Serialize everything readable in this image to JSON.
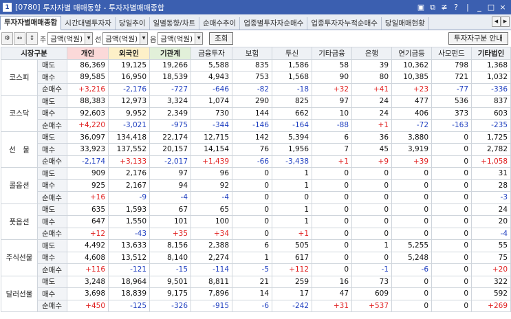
{
  "window": {
    "code": "[0780]",
    "title": "투자자별 매매동향 - 투자자별매매종합",
    "icon_label": "1",
    "controls": [
      "▣",
      "⧉",
      "≢",
      "?",
      "|",
      "_",
      "□",
      "×"
    ]
  },
  "tabs": [
    "투자자별매매종합",
    "시간대별투자자",
    "당일추이",
    "일별동향/차트",
    "순매수추이",
    "업종별투자자순매수",
    "업종투자자누적순매수",
    "당일매매현황"
  ],
  "toolbar": {
    "label_stock": "주",
    "label_futures": "선",
    "label_options": "옵",
    "select_stock": "금액(억원)",
    "select_futures": "금액(억원)",
    "select_options": "금액(억원)",
    "query_button": "조회",
    "guide_button": "투자자구분 안내"
  },
  "headers": [
    "시장구분",
    "개인",
    "외국인",
    "기관계",
    "금융투자",
    "보험",
    "투신",
    "기타금융",
    "은행",
    "연기금등",
    "사모펀드",
    "기타법인"
  ],
  "row_types": [
    "매도",
    "매수",
    "순매수"
  ],
  "markets": [
    {
      "name": "코스피",
      "rows": [
        [
          "86,369",
          "19,125",
          "19,266",
          "5,588",
          "835",
          "1,586",
          "58",
          "39",
          "10,362",
          "798",
          "1,368"
        ],
        [
          "89,585",
          "16,950",
          "18,539",
          "4,943",
          "753",
          "1,568",
          "90",
          "80",
          "10,385",
          "721",
          "1,032"
        ],
        [
          "+3,216",
          "-2,176",
          "-727",
          "-646",
          "-82",
          "-18",
          "+32",
          "+41",
          "+23",
          "-77",
          "-336"
        ]
      ]
    },
    {
      "name": "코스닥",
      "rows": [
        [
          "88,383",
          "12,973",
          "3,324",
          "1,074",
          "290",
          "825",
          "97",
          "24",
          "477",
          "536",
          "837"
        ],
        [
          "92,603",
          "9,952",
          "2,349",
          "730",
          "144",
          "662",
          "10",
          "24",
          "406",
          "373",
          "603"
        ],
        [
          "+4,220",
          "-3,021",
          "-975",
          "-344",
          "-146",
          "-164",
          "-88",
          "+1",
          "-72",
          "-163",
          "-235"
        ]
      ]
    },
    {
      "name": "선　물",
      "rows": [
        [
          "36,097",
          "134,418",
          "22,174",
          "12,715",
          "142",
          "5,394",
          "6",
          "36",
          "3,880",
          "0",
          "1,725"
        ],
        [
          "33,923",
          "137,552",
          "20,157",
          "14,154",
          "76",
          "1,956",
          "7",
          "45",
          "3,919",
          "0",
          "2,782"
        ],
        [
          "-2,174",
          "+3,133",
          "-2,017",
          "+1,439",
          "-66",
          "-3,438",
          "+1",
          "+9",
          "+39",
          "0",
          "+1,058"
        ]
      ]
    },
    {
      "name": "콜옵션",
      "rows": [
        [
          "909",
          "2,176",
          "97",
          "96",
          "0",
          "1",
          "0",
          "0",
          "0",
          "0",
          "31"
        ],
        [
          "925",
          "2,167",
          "94",
          "92",
          "0",
          "1",
          "0",
          "0",
          "0",
          "0",
          "28"
        ],
        [
          "+16",
          "-9",
          "-4",
          "-4",
          "0",
          "0",
          "0",
          "0",
          "0",
          "0",
          "-3"
        ]
      ]
    },
    {
      "name": "풋옵션",
      "rows": [
        [
          "635",
          "1,593",
          "67",
          "65",
          "0",
          "1",
          "0",
          "0",
          "0",
          "0",
          "24"
        ],
        [
          "647",
          "1,550",
          "101",
          "100",
          "0",
          "1",
          "0",
          "0",
          "0",
          "0",
          "20"
        ],
        [
          "+12",
          "-43",
          "+35",
          "+34",
          "0",
          "+1",
          "0",
          "0",
          "0",
          "0",
          "-4"
        ]
      ]
    },
    {
      "name": "주식선물",
      "rows": [
        [
          "4,492",
          "13,633",
          "8,156",
          "2,388",
          "6",
          "505",
          "0",
          "1",
          "5,255",
          "0",
          "55"
        ],
        [
          "4,608",
          "13,512",
          "8,140",
          "2,274",
          "1",
          "617",
          "0",
          "0",
          "5,248",
          "0",
          "75"
        ],
        [
          "+116",
          "-121",
          "-15",
          "-114",
          "-5",
          "+112",
          "0",
          "-1",
          "-6",
          "0",
          "+20"
        ]
      ]
    },
    {
      "name": "달러선물",
      "rows": [
        [
          "3,248",
          "18,964",
          "9,501",
          "8,811",
          "21",
          "259",
          "16",
          "73",
          "0",
          "0",
          "322"
        ],
        [
          "3,698",
          "18,839",
          "9,175",
          "7,896",
          "14",
          "17",
          "47",
          "609",
          "0",
          "0",
          "592"
        ],
        [
          "+450",
          "-125",
          "-326",
          "-915",
          "-6",
          "-242",
          "+31",
          "+537",
          "0",
          "0",
          "+269"
        ]
      ]
    }
  ],
  "colors": {
    "title_bar": "#3b5fb0",
    "positive": "#e02020",
    "negative": "#2040c0",
    "retail_header": "#fbd9d9",
    "foreign_header": "#fdf0c8",
    "inst_header": "#e2f0d9"
  }
}
